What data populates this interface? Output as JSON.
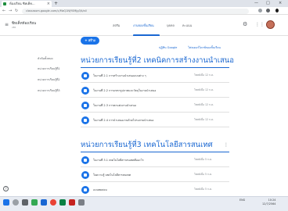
{
  "browser": {
    "tab_title": "ห้องเรียน ซิทเค็ท...",
    "tab_close": "×",
    "new_tab": "+",
    "minimize": "—",
    "maximize": "□",
    "close": "×",
    "back": "←",
    "forward": "→",
    "reload": "↻",
    "url": "classroom.google.com/c/MzQ1NjY0Mjg3/t/all"
  },
  "classroom": {
    "menu_glyph": "≡",
    "class_name": "ซิทเค็ทห้องเรียน",
    "section": "ง30",
    "tabs": [
      {
        "label": "สตรีม"
      },
      {
        "label": "งานของชั้นเรียน"
      },
      {
        "label": "บุคคล"
      },
      {
        "label": "คะแนน"
      }
    ],
    "gear_glyph": "⚙",
    "apps_glyph": "⋮⋮",
    "create_label": "+ สร้าง",
    "link_calendar": "ปฏิทิน Google",
    "link_drive": "โฟลเดอร์ไดรฟ์ของชั้นเรียน",
    "sidebar": [
      {
        "label": "หัวข้อทั้งหมด"
      },
      {
        "label": "หน่วยการเรียนรู้ที่1"
      },
      {
        "label": "หน่วยการเรียนรู้ที่2"
      },
      {
        "label": "หน่วยการเรียนรู้ที่3"
      }
    ],
    "topics": [
      {
        "title": "หน่วยการเรียนรู้ที่2 เทคนิคการสร้างงานนำเสนอ",
        "kebab": "⋮",
        "items": [
          {
            "title": "ใบงานที่ 2.1 การสร้างงานนำเสนอแบบต่าง ๆ",
            "date": "โพสต์เมื่อ 12 ก.ค."
          },
          {
            "title": "ใบงานที่ 2.2 การแทรกรูปภาพและวัตถุในงานนำเสนอ",
            "date": "โพสต์เมื่อ 12 ก.ค."
          },
          {
            "title": "ใบงานที่ 2.3 การตกแต่งงานนำเสนอ",
            "date": "โพสต์เมื่อ 12 ก.ค."
          },
          {
            "title": "ใบงานที่ 2.4 การนำเสนองานด้วยโปรแกรมนำเสนอ",
            "date": "โพสต์เมื่อ 12 ก.ค."
          }
        ]
      },
      {
        "title": "หน่วยการเรียนรู้ที่3 เทคโนโลยีสารสนเทศ",
        "kebab": "⋮",
        "items": [
          {
            "title": "ใบงานที่ 3.1 เทคโนโลยีสารสนเทศคืออะไร",
            "date": "โพสต์เมื่อ 5 ก.ค."
          },
          {
            "title": "ใบความรู้ เทคโนโลยีสารสนเทศ",
            "date": "โพสต์เมื่อ 5 ก.ค."
          },
          {
            "title": "แบบทดสอบ",
            "date": "โพสต์เมื่อ 5 ก.ค."
          }
        ]
      }
    ],
    "help_glyph": "?"
  },
  "taskbar": {
    "time": "10:24",
    "date": "12/7/2564",
    "lang": "ENG"
  },
  "colors": {
    "accent": "#1967d2",
    "button": "#1a73e8",
    "taskbar": "#e8ecf3"
  }
}
